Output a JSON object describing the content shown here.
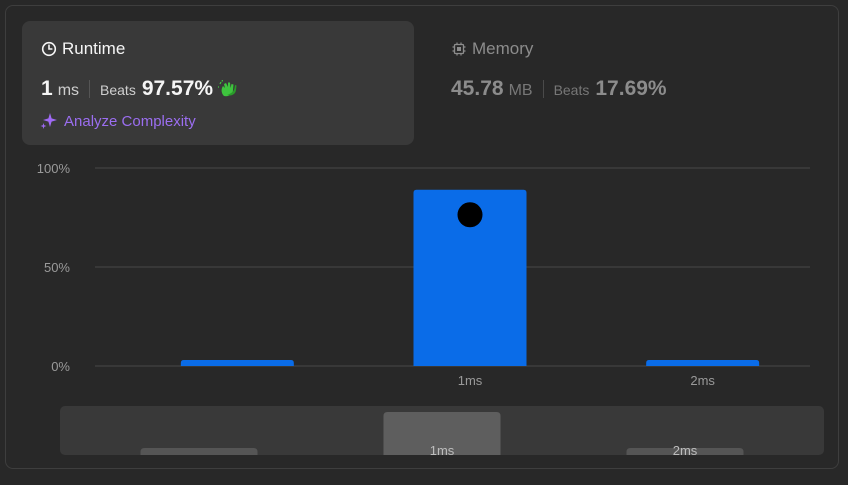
{
  "runtime": {
    "title": "Runtime",
    "value": "1",
    "unit": "ms",
    "beats_label": "Beats",
    "beats_value": "97.57%",
    "analyze_label": "Analyze Complexity"
  },
  "memory": {
    "title": "Memory",
    "value": "45.78",
    "unit": "MB",
    "beats_label": "Beats",
    "beats_value": "17.69%"
  },
  "colors": {
    "bar": "#0a6ce8",
    "accent_purple": "#9b6ef0",
    "marker": "#000000"
  },
  "chart_data": {
    "type": "bar",
    "categories": [
      "",
      "1ms",
      "2ms"
    ],
    "values": [
      3,
      89,
      3
    ],
    "ylim": [
      0,
      100
    ],
    "y_ticks": [
      "0%",
      "50%",
      "100%"
    ],
    "marker_category": "1ms",
    "grid": true,
    "overview": {
      "type": "bar",
      "categories": [
        "",
        "1ms",
        "2ms"
      ],
      "highlight": "1ms"
    }
  }
}
